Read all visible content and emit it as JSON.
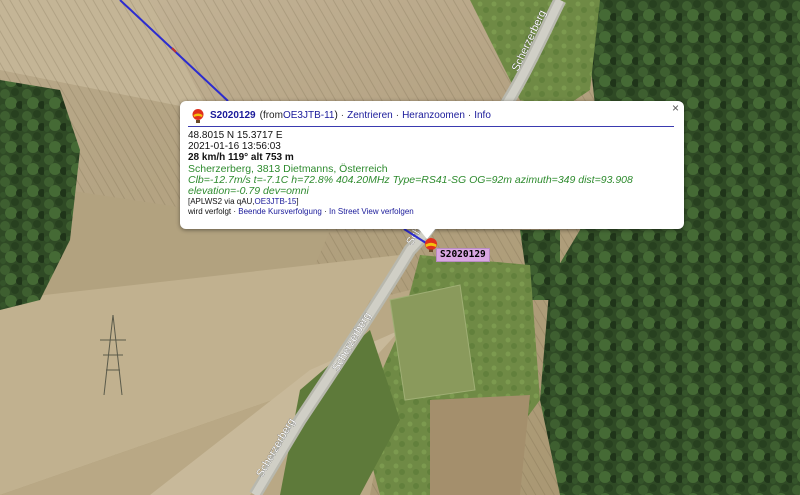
{
  "map": {
    "road_labels": [
      "Scherzerberg",
      "Scherzerberg",
      "Scherzerberg",
      "Sch"
    ],
    "track_color": "#2c2ccf"
  },
  "popup": {
    "icon": "balloon-icon",
    "callsign": "S2020129",
    "from_prefix": "(from ",
    "from_station": "OE3JTB-11",
    "from_suffix": ")",
    "links": [
      "Zentrieren",
      "Heranzoomen",
      "Info"
    ],
    "coords": "48.8015 N 15.3717 E",
    "timestamp": "2021-01-16 13:56:03",
    "motion": "28 km/h 119° alt 753 m",
    "address": "Scherzerberg, 3813 Dietmanns, Österreich",
    "comment_line1": "Clb=-12.7m/s t=-7.1C h=72.8% 404.20MHz Type=RS41-SG OG=92m azimuth=349 dist=93.908",
    "comment_line2": "elevation=-0.79 dev=omni",
    "path_prefix": "[APLWS2 via qAU,",
    "path_station": "OE3JTB-15",
    "path_suffix": "]",
    "tracking_prefix": "wird verfolgt · ",
    "tracking_links": [
      "Beende Kursverfolgung",
      "In Street View verfolgen"
    ],
    "close": "×"
  },
  "marker": {
    "label": "S2020129"
  },
  "colors": {
    "link": "#1a1a9a",
    "comment": "#2e8b2e",
    "marker_label_bg": "#d9a6e2"
  }
}
